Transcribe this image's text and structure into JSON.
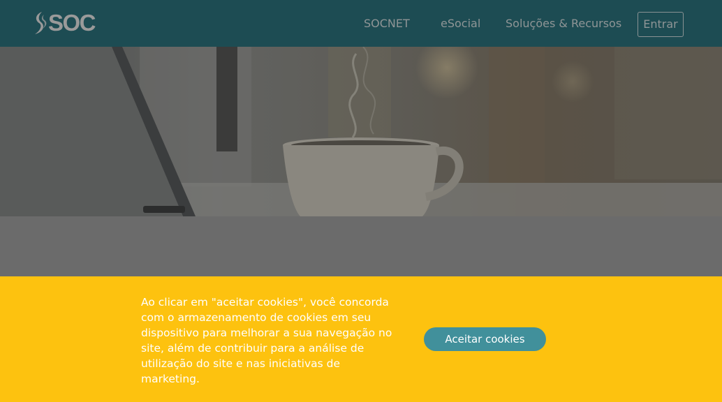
{
  "header": {
    "logo_text": "SOC",
    "nav": {
      "socnet": "SOCNET",
      "esocial": "eSocial",
      "solucoes": "Soluções & Recursos"
    },
    "login_label": "Entrar"
  },
  "hero": {
    "image": "coffee-cup-laptop-photo"
  },
  "cookie_banner": {
    "text": "Ao clicar em \"aceitar cookies\", você concorda com o armazenamento de cookies em seu dispositivo para melhorar a sua navegação no site, além de contribuir para a análise de utilização do site e nas iniciativas de marketing.",
    "accept_label": "Aceitar cookies"
  },
  "colors": {
    "header_bg": "#1d4c53",
    "banner_bg": "#fdc20f",
    "accept_button": "#41909b"
  }
}
